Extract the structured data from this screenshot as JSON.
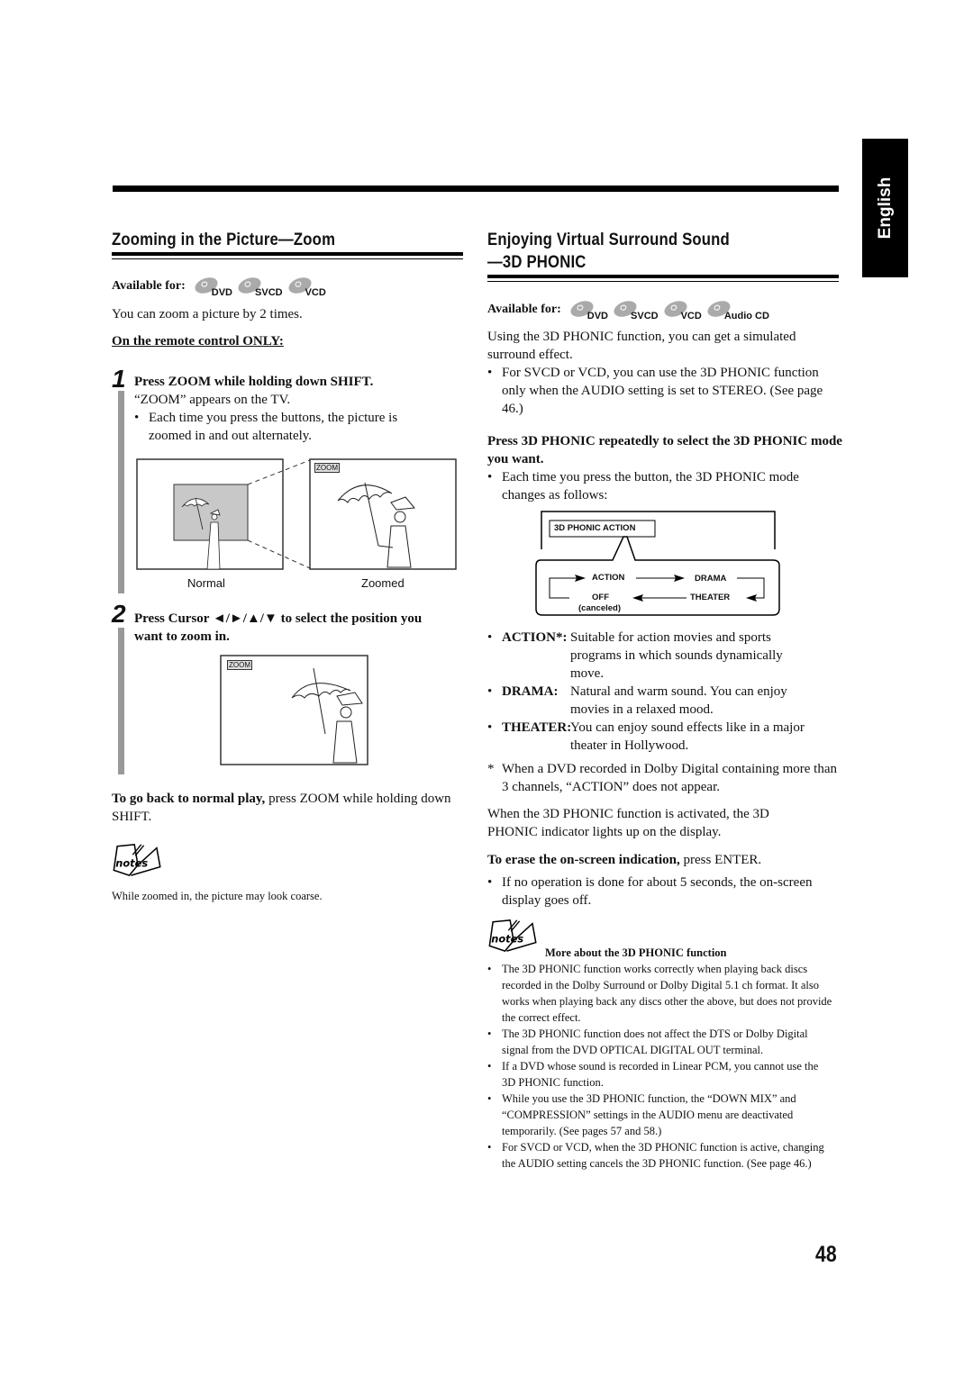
{
  "language_tab": "English",
  "page_number": "48",
  "left": {
    "title": "Zooming in the Picture—Zoom",
    "available_label": "Available for:",
    "discs": [
      "DVD",
      "SVCD",
      "VCD"
    ],
    "intro": "You can zoom a picture by 2 times.",
    "remote_note": "On the remote control ONLY:",
    "step1": {
      "number": "1",
      "heading": "Press ZOOM while holding down SHIFT.",
      "text": "“ZOOM” appears on the TV.",
      "bullet": "Each time you press the buttons, the picture is zoomed in and out alternately.",
      "zoom_tag": "ZOOM",
      "caption_normal": "Normal",
      "caption_zoomed": "Zoomed"
    },
    "step2": {
      "number": "2",
      "heading": "Press Cursor ◄/►/▲/▼ to select the position you want to zoom in.",
      "zoom_tag": "ZOOM"
    },
    "back_bold": "To go back to normal play,",
    "back_text": " press ZOOM while holding down SHIFT.",
    "notes_icon_label": "notes",
    "note": "While zoomed in, the picture may look coarse."
  },
  "right": {
    "title_line1": "Enjoying Virtual Surround Sound",
    "title_line2": "—3D PHONIC",
    "available_label": "Available for:",
    "discs": [
      "DVD",
      "SVCD",
      "VCD",
      "Audio CD"
    ],
    "intro": "Using the 3D PHONIC function, you can get a simulated surround effect.",
    "bullet1": "For SVCD or VCD, you can use the 3D PHONIC function only when the AUDIO setting is set to STEREO. (See page 46.)",
    "instruction": "Press 3D PHONIC repeatedly to select the 3D PHONIC mode you want.",
    "bullet2": "Each time you press the button, the 3D PHONIC mode changes as follows:",
    "diagram": {
      "osd": "3D PHONIC   ACTION",
      "action": "ACTION",
      "drama": "DRAMA",
      "theater": "THEATER",
      "off": "OFF",
      "canceled": "(canceled)"
    },
    "modes": [
      {
        "term": "ACTION*:",
        "desc": "Suitable for action movies and sports programs in which sounds dynamically move."
      },
      {
        "term": "DRAMA:",
        "desc": "Natural and warm sound. You can enjoy movies in a relaxed mood."
      },
      {
        "term": "THEATER:",
        "desc": "You can enjoy sound effects like in a major theater in Hollywood."
      }
    ],
    "footnote_mark": "*",
    "footnote": "When a DVD recorded in Dolby Digital containing more than 3 channels, “ACTION” does not appear.",
    "indicator": "When the 3D PHONIC function is activated, the 3D PHONIC indicator lights up on the display.",
    "erase_bold": "To erase the on-screen indication,",
    "erase_text": " press ENTER.",
    "bullet3": "If no operation is done for about 5 seconds, the on-screen display goes off.",
    "notes_icon_label": "notes",
    "notes_heading": "More about the 3D PHONIC function",
    "notes": [
      "The 3D PHONIC function works correctly when playing back discs recorded in the Dolby Surround or Dolby Digital 5.1 ch format. It also works when playing back any discs other the above, but does not provide the correct effect.",
      "The 3D PHONIC function does not affect the DTS or Dolby Digital signal from the DVD OPTICAL DIGITAL OUT terminal.",
      "If a DVD whose sound is recorded in Linear PCM, you cannot use the 3D PHONIC function.",
      "While you use the 3D PHONIC function, the “DOWN MIX” and “COMPRESSION” settings in the AUDIO menu are deactivated temporarily. (See pages 57 and 58.)",
      "For SVCD or VCD, when the 3D PHONIC function is active, changing the AUDIO setting cancels the 3D PHONIC function. (See page 46.)"
    ]
  }
}
